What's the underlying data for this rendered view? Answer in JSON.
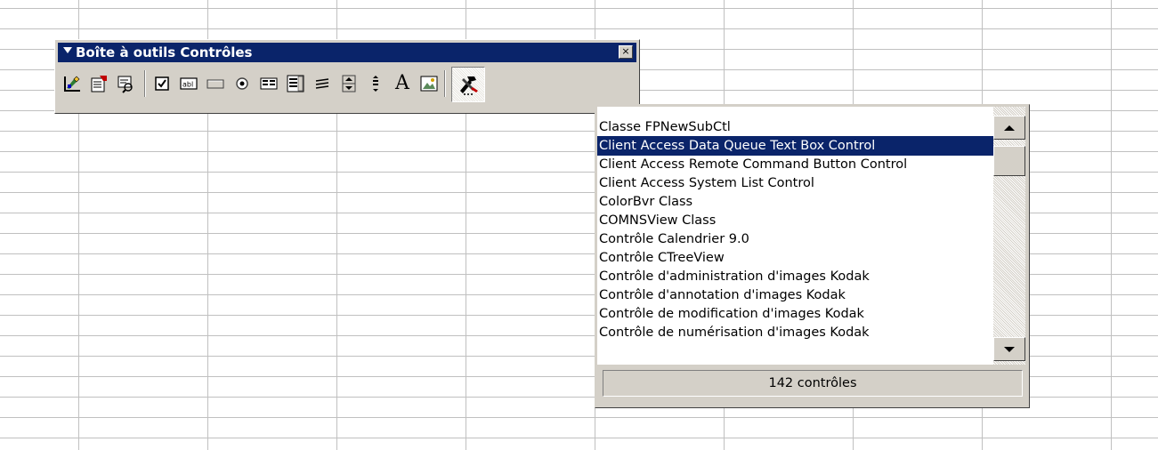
{
  "toolbox": {
    "title": "Boîte à outils Contrôles",
    "close_glyph": "×",
    "tools": [
      {
        "name": "design-mode-icon"
      },
      {
        "name": "properties-icon"
      },
      {
        "name": "view-code-icon"
      },
      {
        "name": "checkbox-icon"
      },
      {
        "name": "textbox-icon"
      },
      {
        "name": "command-button-icon"
      },
      {
        "name": "option-button-icon"
      },
      {
        "name": "listbox-icon"
      },
      {
        "name": "combobox-icon"
      },
      {
        "name": "toggle-button-icon"
      },
      {
        "name": "spin-button-icon"
      },
      {
        "name": "scrollbar-icon"
      },
      {
        "name": "label-icon"
      },
      {
        "name": "image-icon"
      },
      {
        "name": "more-controls-icon"
      }
    ],
    "label_glyph": "A"
  },
  "controls_list": {
    "items": [
      "Classe FPNewSubCtl",
      "Client Access Data Queue Text Box Control",
      "Client Access Remote Command Button Control",
      "Client Access System List Control",
      "ColorBvr Class",
      "COMNSView Class",
      "Contrôle Calendrier 9.0",
      "Contrôle CTreeView",
      "Contrôle d'administration d'images Kodak",
      "Contrôle d'annotation d'images Kodak",
      "Contrôle de modification d'images Kodak",
      "Contrôle de numérisation d'images Kodak"
    ],
    "selected_item": "Client Access Data Queue Text Box Control",
    "status": "142 contrôles"
  },
  "colors": {
    "title_bar": "#0a246a",
    "face": "#d4d0c8",
    "selection": "#0a246a"
  }
}
